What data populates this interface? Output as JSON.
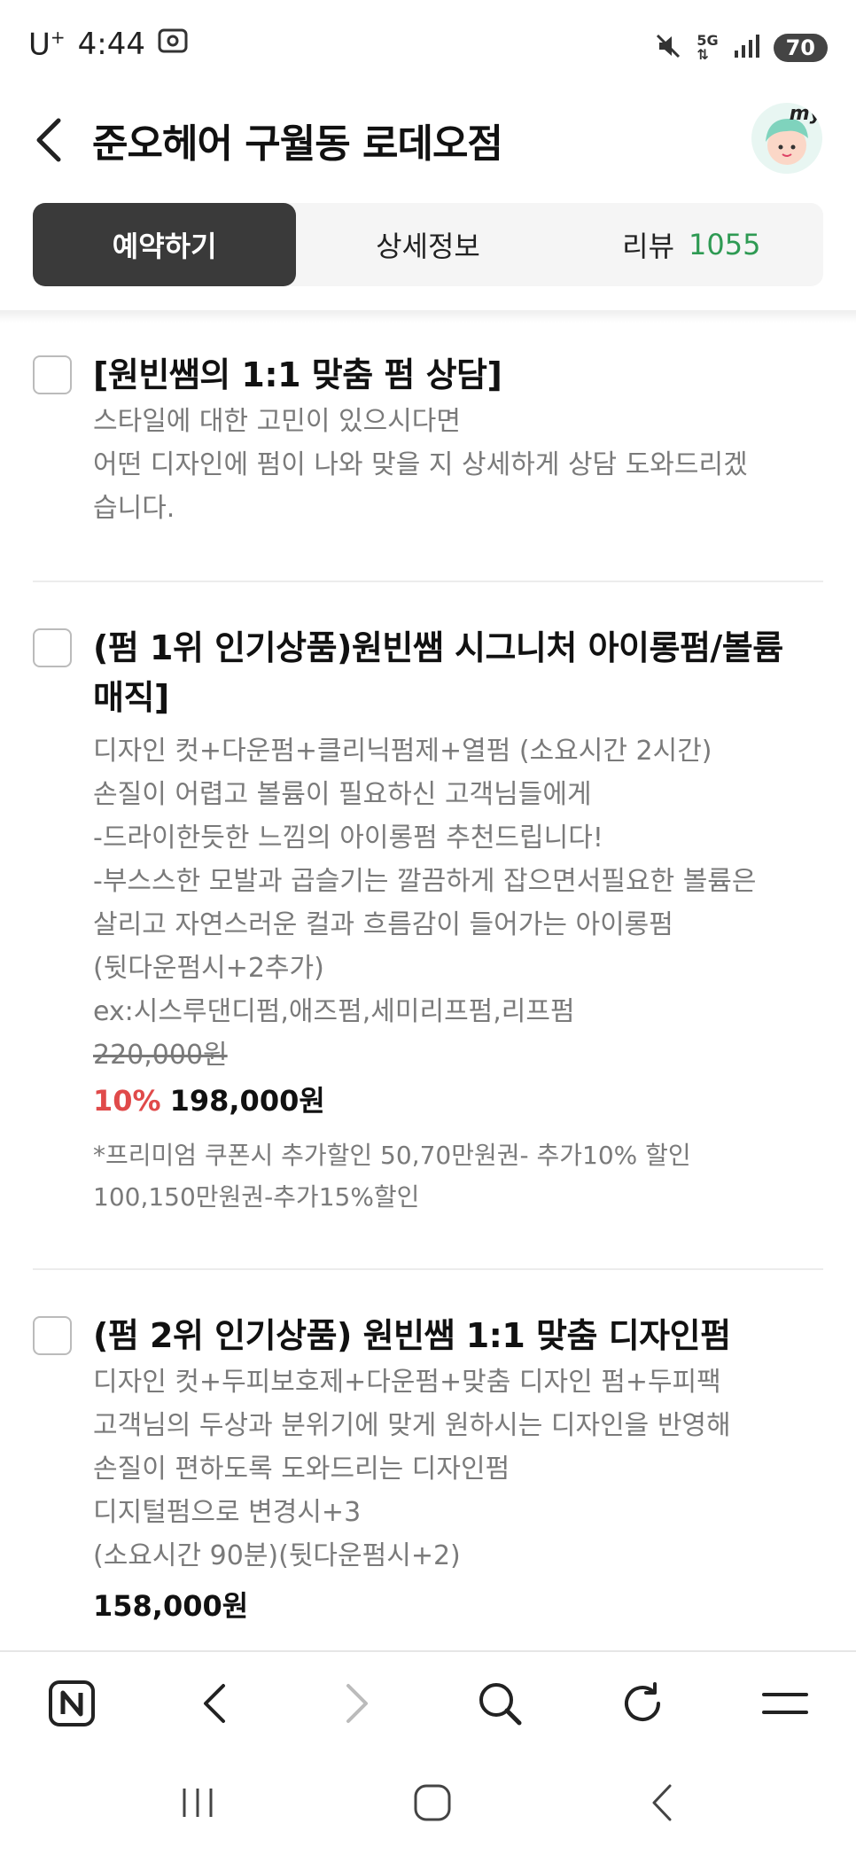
{
  "status_bar": {
    "carrier": "U",
    "carrier_sup": "+",
    "time": "4:44",
    "battery": "70"
  },
  "header": {
    "title": "준오헤어 구월동 로데오점",
    "avatar_text": "my"
  },
  "tabs": [
    {
      "label": "예약하기",
      "active": true
    },
    {
      "label": "상세정보",
      "active": false
    },
    {
      "label": "리뷰",
      "count": "1055",
      "active": false
    }
  ],
  "items": [
    {
      "title_lines": [
        "[원빈쌤의 1:1 맞춤 펌 상담]"
      ],
      "desc_lines": [
        "스타일에 대한 고민이 있으시다면",
        "어떤 디자인에 펌이 나와 맞을 지 상세하게 상담 도와드리겠",
        "습니다."
      ]
    },
    {
      "title_lines": [
        "(펌 1위 인기상품)원빈쌤 시그니처 아이롱펌/볼륨",
        "매직]"
      ],
      "desc_lines": [
        "디자인 컷+다운펌+클리닉펌제+열펌 (소요시간 2시간)",
        "손질이 어렵고 볼륨이 필요하신 고객님들에게",
        "-드라이한듯한 느낌의 아이롱펌 추천드립니다!",
        "-부스스한 모발과 곱슬기는 깔끔하게 잡으면서필요한 볼륨은",
        "살리고 자연스러운 컬과 흐름감이 들어가는 아이롱펌",
        "(뒷다운펌시+2추가)",
        "ex:시스루댄디펌,애즈펌,세미리프펌,리프펌"
      ],
      "original_price": "220,000원",
      "discount": "10%",
      "price": "198,000원",
      "note_lines": [
        "*프리미엄 쿠폰시 추가할인 50,70만원권- 추가10% 할인",
        "100,150만원권-추가15%할인"
      ]
    },
    {
      "title_lines": [
        "(펌 2위 인기상품) 원빈쌤 1:1 맞춤 디자인펌"
      ],
      "desc_lines": [
        "디자인 컷+두피보호제+다운펌+맞춤 디자인 펌+두피팩",
        "고객님의 두상과 분위기에 맞게 원하시는 디자인을 반영해",
        "손질이 편하도록 도와드리는 디자인펌",
        "디지털펌으로 변경시+3",
        "(소요시간 90분)(뒷다운펌시+2)"
      ],
      "price": "158,000원"
    }
  ],
  "browser_bar": [
    "naver-home-icon",
    "back-icon",
    "forward-icon",
    "search-icon",
    "refresh-icon",
    "menu-icon"
  ],
  "colors": {
    "accent_green": "#2e9a53",
    "discount_red": "#e04a4a",
    "active_tab": "#3a3a3a"
  }
}
